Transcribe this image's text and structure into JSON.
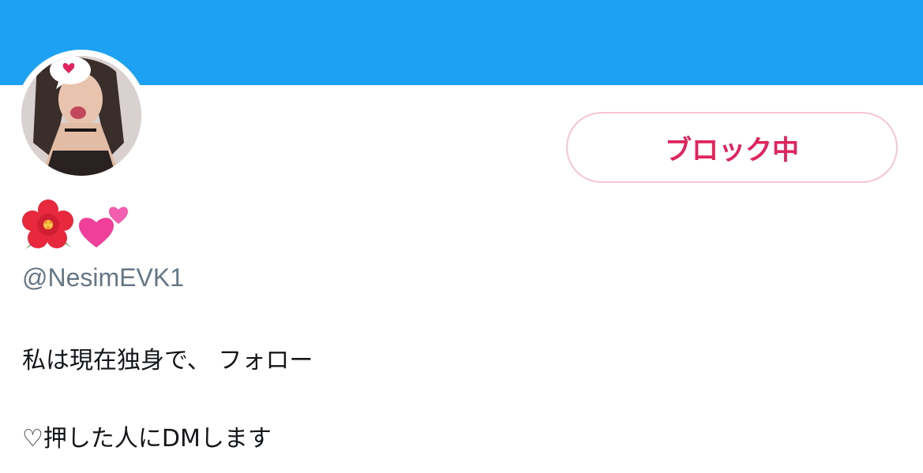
{
  "profile": {
    "handle": "@NesimEVK1",
    "display_name_icons": [
      "hibiscus-icon",
      "two-hearts-icon"
    ],
    "avatar_icon": "profile-photo"
  },
  "actions": {
    "block_label": "ブロック中"
  },
  "bio": {
    "line1": "私は現在独身で、 フォロー",
    "line2": "♡押した人にDMします"
  },
  "colors": {
    "banner": "#1da1f2",
    "block_text": "#e0245e",
    "block_border": "#f5c6cf",
    "handle": "#657786"
  }
}
